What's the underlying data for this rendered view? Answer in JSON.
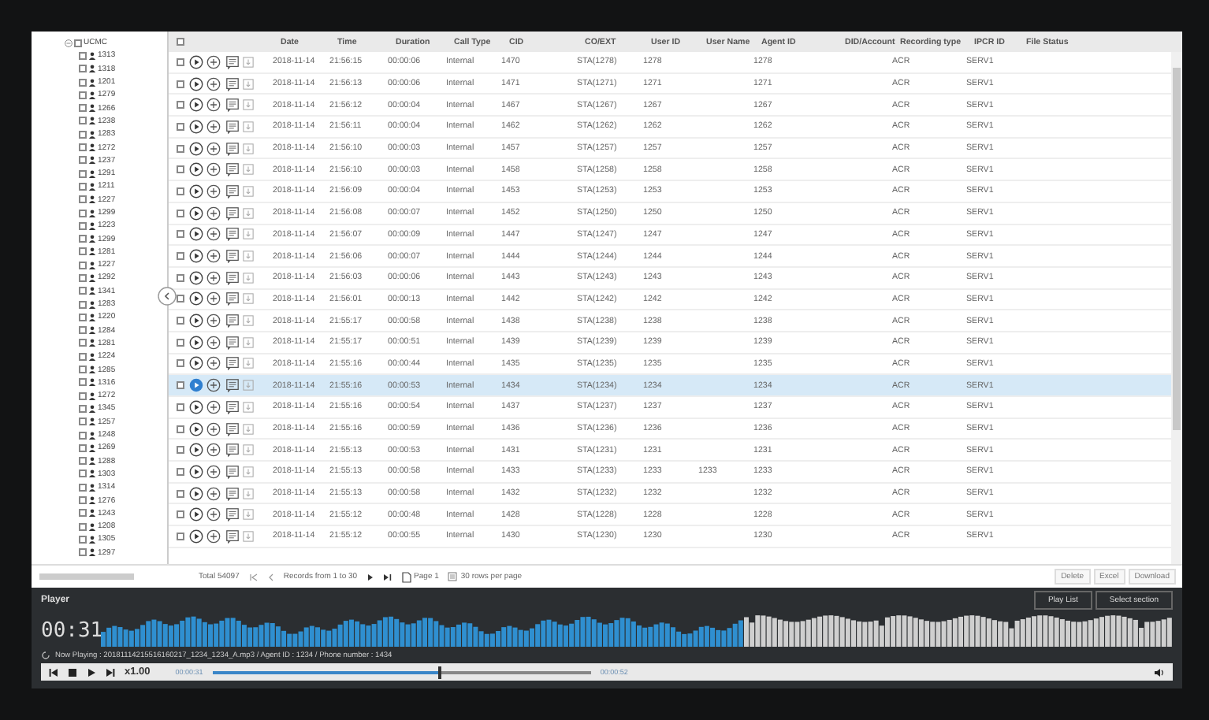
{
  "tree": {
    "label": "UCMC",
    "expanded": true,
    "checked": false,
    "children": [
      {
        "label": "1313",
        "checked": false
      },
      {
        "label": "1318",
        "checked": false
      },
      {
        "label": "1201",
        "checked": false
      },
      {
        "label": "1279",
        "checked": false
      },
      {
        "label": "1266",
        "checked": false
      },
      {
        "label": "1238",
        "checked": false
      },
      {
        "label": "1283",
        "checked": false
      },
      {
        "label": "1272",
        "checked": false
      },
      {
        "label": "1237",
        "checked": false
      },
      {
        "label": "1291",
        "checked": false
      },
      {
        "label": "1211",
        "checked": false
      },
      {
        "label": "1227",
        "checked": false
      },
      {
        "label": "1299",
        "checked": false
      },
      {
        "label": "1223",
        "checked": false
      },
      {
        "label": "1299",
        "checked": false
      },
      {
        "label": "1281",
        "checked": false
      },
      {
        "label": "1227",
        "checked": false
      },
      {
        "label": "1292",
        "checked": false
      },
      {
        "label": "1341",
        "checked": false
      },
      {
        "label": "1283",
        "checked": false
      },
      {
        "label": "1220",
        "checked": false
      },
      {
        "label": "1284",
        "checked": false
      },
      {
        "label": "1281",
        "checked": false
      },
      {
        "label": "1224",
        "checked": false
      },
      {
        "label": "1285",
        "checked": false
      },
      {
        "label": "1316",
        "checked": false
      },
      {
        "label": "1272",
        "checked": false
      },
      {
        "label": "1345",
        "checked": false
      },
      {
        "label": "1257",
        "checked": false
      },
      {
        "label": "1248",
        "checked": false
      },
      {
        "label": "1269",
        "checked": false
      },
      {
        "label": "1288",
        "checked": false
      },
      {
        "label": "1303",
        "checked": false
      },
      {
        "label": "1314",
        "checked": false
      },
      {
        "label": "1276",
        "checked": false
      },
      {
        "label": "1243",
        "checked": false
      },
      {
        "label": "1208",
        "checked": false
      },
      {
        "label": "1305",
        "checked": false
      },
      {
        "label": "1297",
        "checked": false
      }
    ]
  },
  "table": {
    "header_checked": false,
    "columns": [
      "Date",
      "Time",
      "Duration",
      "Call Type",
      "CID",
      "CO/EXT",
      "User ID",
      "User Name",
      "Agent ID",
      "DID/Account",
      "Recording type",
      "IPCR ID",
      "File Status"
    ],
    "rows": [
      {
        "selected": false,
        "checked": false,
        "cells": [
          "2018-11-14",
          "21:56:15",
          "00:00:06",
          "Internal",
          "1470",
          "STA(1278)",
          "1278",
          "",
          "1278",
          "",
          "ACR",
          "SERV1",
          ""
        ]
      },
      {
        "selected": false,
        "checked": false,
        "cells": [
          "2018-11-14",
          "21:56:13",
          "00:00:06",
          "Internal",
          "1471",
          "STA(1271)",
          "1271",
          "",
          "1271",
          "",
          "ACR",
          "SERV1",
          ""
        ]
      },
      {
        "selected": false,
        "checked": false,
        "cells": [
          "2018-11-14",
          "21:56:12",
          "00:00:04",
          "Internal",
          "1467",
          "STA(1267)",
          "1267",
          "",
          "1267",
          "",
          "ACR",
          "SERV1",
          ""
        ]
      },
      {
        "selected": false,
        "checked": false,
        "cells": [
          "2018-11-14",
          "21:56:11",
          "00:00:04",
          "Internal",
          "1462",
          "STA(1262)",
          "1262",
          "",
          "1262",
          "",
          "ACR",
          "SERV1",
          ""
        ]
      },
      {
        "selected": false,
        "checked": false,
        "cells": [
          "2018-11-14",
          "21:56:10",
          "00:00:03",
          "Internal",
          "1457",
          "STA(1257)",
          "1257",
          "",
          "1257",
          "",
          "ACR",
          "SERV1",
          ""
        ]
      },
      {
        "selected": false,
        "checked": false,
        "cells": [
          "2018-11-14",
          "21:56:10",
          "00:00:03",
          "Internal",
          "1458",
          "STA(1258)",
          "1258",
          "",
          "1258",
          "",
          "ACR",
          "SERV1",
          ""
        ]
      },
      {
        "selected": false,
        "checked": false,
        "cells": [
          "2018-11-14",
          "21:56:09",
          "00:00:04",
          "Internal",
          "1453",
          "STA(1253)",
          "1253",
          "",
          "1253",
          "",
          "ACR",
          "SERV1",
          ""
        ]
      },
      {
        "selected": false,
        "checked": false,
        "cells": [
          "2018-11-14",
          "21:56:08",
          "00:00:07",
          "Internal",
          "1452",
          "STA(1250)",
          "1250",
          "",
          "1250",
          "",
          "ACR",
          "SERV1",
          ""
        ]
      },
      {
        "selected": false,
        "checked": false,
        "cells": [
          "2018-11-14",
          "21:56:07",
          "00:00:09",
          "Internal",
          "1447",
          "STA(1247)",
          "1247",
          "",
          "1247",
          "",
          "ACR",
          "SERV1",
          ""
        ]
      },
      {
        "selected": false,
        "checked": false,
        "cells": [
          "2018-11-14",
          "21:56:06",
          "00:00:07",
          "Internal",
          "1444",
          "STA(1244)",
          "1244",
          "",
          "1244",
          "",
          "ACR",
          "SERV1",
          ""
        ]
      },
      {
        "selected": false,
        "checked": false,
        "cells": [
          "2018-11-14",
          "21:56:03",
          "00:00:06",
          "Internal",
          "1443",
          "STA(1243)",
          "1243",
          "",
          "1243",
          "",
          "ACR",
          "SERV1",
          ""
        ]
      },
      {
        "selected": false,
        "checked": false,
        "cells": [
          "2018-11-14",
          "21:56:01",
          "00:00:13",
          "Internal",
          "1442",
          "STA(1242)",
          "1242",
          "",
          "1242",
          "",
          "ACR",
          "SERV1",
          ""
        ]
      },
      {
        "selected": false,
        "checked": false,
        "cells": [
          "2018-11-14",
          "21:55:17",
          "00:00:58",
          "Internal",
          "1438",
          "STA(1238)",
          "1238",
          "",
          "1238",
          "",
          "ACR",
          "SERV1",
          ""
        ]
      },
      {
        "selected": false,
        "checked": false,
        "cells": [
          "2018-11-14",
          "21:55:17",
          "00:00:51",
          "Internal",
          "1439",
          "STA(1239)",
          "1239",
          "",
          "1239",
          "",
          "ACR",
          "SERV1",
          ""
        ]
      },
      {
        "selected": false,
        "checked": false,
        "cells": [
          "2018-11-14",
          "21:55:16",
          "00:00:44",
          "Internal",
          "1435",
          "STA(1235)",
          "1235",
          "",
          "1235",
          "",
          "ACR",
          "SERV1",
          ""
        ]
      },
      {
        "selected": true,
        "checked": false,
        "cells": [
          "2018-11-14",
          "21:55:16",
          "00:00:53",
          "Internal",
          "1434",
          "STA(1234)",
          "1234",
          "",
          "1234",
          "",
          "ACR",
          "SERV1",
          ""
        ]
      },
      {
        "selected": false,
        "checked": false,
        "cells": [
          "2018-11-14",
          "21:55:16",
          "00:00:54",
          "Internal",
          "1437",
          "STA(1237)",
          "1237",
          "",
          "1237",
          "",
          "ACR",
          "SERV1",
          ""
        ]
      },
      {
        "selected": false,
        "checked": false,
        "cells": [
          "2018-11-14",
          "21:55:16",
          "00:00:59",
          "Internal",
          "1436",
          "STA(1236)",
          "1236",
          "",
          "1236",
          "",
          "ACR",
          "SERV1",
          ""
        ]
      },
      {
        "selected": false,
        "checked": false,
        "cells": [
          "2018-11-14",
          "21:55:13",
          "00:00:53",
          "Internal",
          "1431",
          "STA(1231)",
          "1231",
          "",
          "1231",
          "",
          "ACR",
          "SERV1",
          ""
        ]
      },
      {
        "selected": false,
        "checked": false,
        "cells": [
          "2018-11-14",
          "21:55:13",
          "00:00:58",
          "Internal",
          "1433",
          "STA(1233)",
          "1233",
          "1233",
          "1233",
          "",
          "ACR",
          "SERV1",
          ""
        ]
      },
      {
        "selected": false,
        "checked": false,
        "cells": [
          "2018-11-14",
          "21:55:13",
          "00:00:58",
          "Internal",
          "1432",
          "STA(1232)",
          "1232",
          "",
          "1232",
          "",
          "ACR",
          "SERV1",
          ""
        ]
      },
      {
        "selected": false,
        "checked": false,
        "cells": [
          "2018-11-14",
          "21:55:12",
          "00:00:48",
          "Internal",
          "1428",
          "STA(1228)",
          "1228",
          "",
          "1228",
          "",
          "ACR",
          "SERV1",
          ""
        ]
      },
      {
        "selected": false,
        "checked": false,
        "cells": [
          "2018-11-14",
          "21:55:12",
          "00:00:55",
          "Internal",
          "1430",
          "STA(1230)",
          "1230",
          "",
          "1230",
          "",
          "ACR",
          "SERV1",
          ""
        ]
      }
    ]
  },
  "footer": {
    "total": "Total 54097",
    "records": "Records from 1 to 30",
    "page": "Page 1",
    "rows_per_page": "30 rows per page",
    "buttons": [
      "Delete",
      "Excel",
      "Download"
    ]
  },
  "player": {
    "title": "Player",
    "buttons": [
      "Play List",
      "Select section"
    ],
    "clock": "00:31",
    "now_playing": "Now Playing : 20181114215516160217_1234_1234_A.mp3 / Agent ID : 1234 / Phone number : 1434",
    "speed": "x1.00",
    "elapsed": "00:00:31",
    "total": "00:00:52",
    "level": 0.6
  }
}
